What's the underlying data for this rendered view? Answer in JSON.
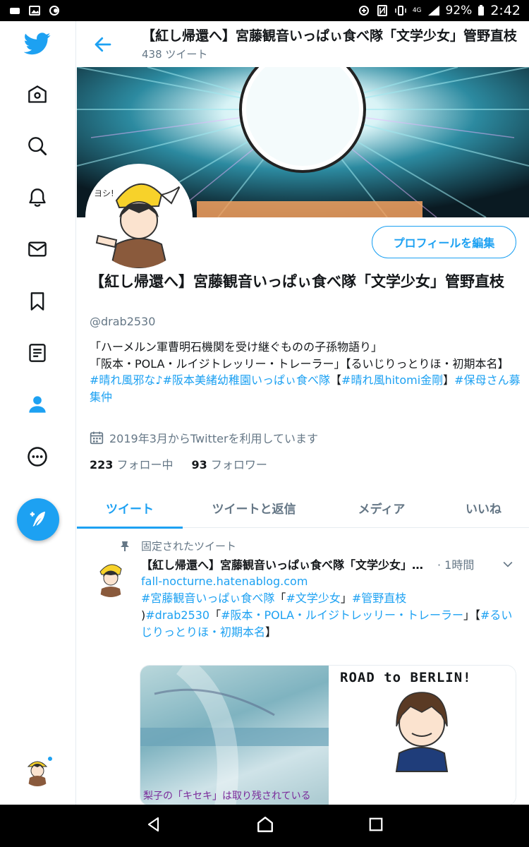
{
  "status_bar": {
    "battery": "92%",
    "time": "2:42",
    "network": "4G"
  },
  "rail": {
    "icons": [
      "twitter-logo-icon",
      "home-icon",
      "search-icon",
      "notifications-icon",
      "messages-icon",
      "bookmarks-icon",
      "lists-icon",
      "profile-icon",
      "more-icon"
    ],
    "accent": "#1da1f2"
  },
  "header": {
    "title": "【紅し帰還へ】宮藤観音いっぱぃ食べ隊「文学少女」管野直枝",
    "tweet_count": "438 ツイート"
  },
  "profile": {
    "edit_button": "プロフィールを編集",
    "name": "【紅し帰還へ】宮藤観音いっぱぃ食べ隊「文学少女」管野直枝",
    "handle": "@drab2530",
    "bio_line1": "「ハーメルン軍曹明石機関を受け継ぐものの子孫物語り」",
    "bio_line2": "「阪本・POLA・ルイジトレッリー・トレーラー」【るいじりっとりほ・初期本名】",
    "bio_tags": "#晴れ風邪な♪#阪本美緒幼稚園いっぱぃ食べ隊",
    "bio_tags_mid": "【",
    "bio_tags2": "#晴れ風hitomi金剛",
    "bio_tags_end": "】",
    "bio_tags3": "#保母さん募集仲",
    "joined": "2019年3月からTwitterを利用しています",
    "following_count": "223",
    "following_label": "フォロー中",
    "followers_count": "93",
    "followers_label": "フォロワー"
  },
  "tabs": [
    {
      "label": "ツイート",
      "active": true
    },
    {
      "label": "ツイートと返信",
      "active": false
    },
    {
      "label": "メディア",
      "active": false
    },
    {
      "label": "いいね",
      "active": false
    }
  ],
  "tweet": {
    "pinned_label": "固定されたツイート",
    "author": "【紅し帰還へ】宮藤観音いっぱぃ食べ隊「文学少女」管野直枝",
    "time": "· 1時間",
    "link": "fall-nocturne.hatenablog.com",
    "line2a": "#宮藤観音いっぱぃ食べ隊",
    "line2b": "「",
    "line2c": "#文学少女",
    "line2d": "」",
    "line2e": "#管野直枝",
    "line3a": ")#drab2530",
    "line3b": "「",
    "line3c": "#阪本・POLA・ルイジトレッリー・トレーラー",
    "line3d": "」【",
    "line3e": "#るいじりっとりほ・初期本名",
    "line3f": "】",
    "media_caption": "梨子の「キセキ」は取り残されている",
    "media_title": "ROAD to BERLIN!"
  }
}
